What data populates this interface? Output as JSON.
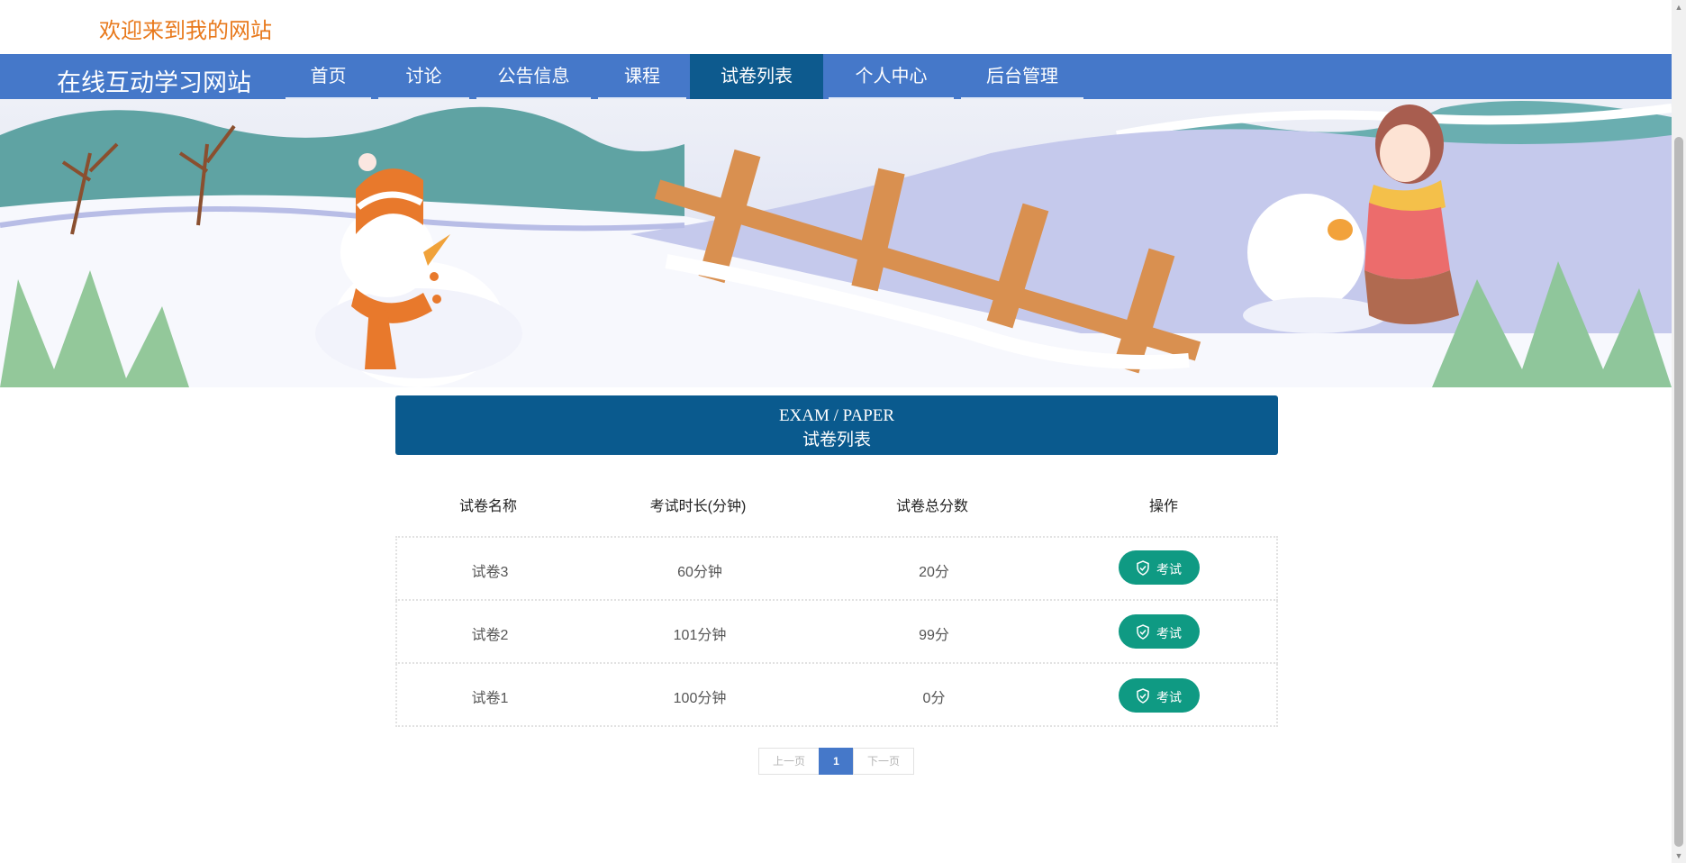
{
  "header": {
    "welcome": "欢迎来到我的网站"
  },
  "nav": {
    "brand": "在线互动学习网站",
    "items": [
      {
        "label": "首页",
        "active": false
      },
      {
        "label": "讨论",
        "active": false
      },
      {
        "label": "公告信息",
        "active": false
      },
      {
        "label": "课程",
        "active": false
      },
      {
        "label": "试卷列表",
        "active": true
      },
      {
        "label": "个人中心",
        "active": false
      },
      {
        "label": "后台管理",
        "active": false
      }
    ]
  },
  "carousel": {
    "slide_count": 3,
    "active_index": 0
  },
  "section": {
    "title_en": "EXAM / PAPER",
    "title_zh": "试卷列表"
  },
  "table": {
    "columns": [
      "试卷名称",
      "考试时长(分钟)",
      "试卷总分数",
      "操作"
    ],
    "rows": [
      {
        "name": "试卷3",
        "duration": "60分钟",
        "score": "20分",
        "action": "考试"
      },
      {
        "name": "试卷2",
        "duration": "101分钟",
        "score": "99分",
        "action": "考试"
      },
      {
        "name": "试卷1",
        "duration": "100分钟",
        "score": "0分",
        "action": "考试"
      }
    ]
  },
  "pagination": {
    "prev": "上一页",
    "current": "1",
    "next": "下一页"
  },
  "icons": {
    "exam_button_icon": "shield-check-icon"
  },
  "colors": {
    "nav_background": "#4578c9",
    "nav_active": "#0d5a8e",
    "section_header": "#0a5a8e",
    "exam_button": "#0f9a83",
    "welcome_text": "#e8791c"
  }
}
